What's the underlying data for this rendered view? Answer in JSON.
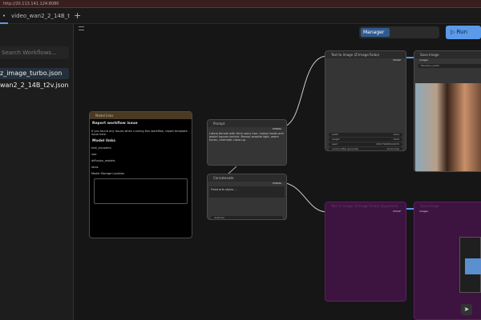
{
  "browser": {
    "url": "http://20.113.141.124:8080"
  },
  "tabs": [
    {
      "label": "•",
      "active": true
    },
    {
      "label": "video_wan2_2_14B_t...",
      "active": false
    }
  ],
  "add_tab": "+",
  "sidebar": {
    "search_placeholder": "Search Workflows...",
    "workflows": [
      {
        "label": "z_image_turbo.json",
        "selected": true
      },
      {
        "label": "wan2_2_14B_t2v.json",
        "selected": false
      }
    ]
  },
  "toolbar": {
    "manager": "Manager",
    "run": "Run"
  },
  "nodes": {
    "model_links": {
      "title": "Model links",
      "heading": "Report workflow issue",
      "intro": "If you found any issues when running this workflow, report template issue here",
      "subheading": "Model links",
      "sections": [
        "text_encoders",
        "vae",
        "diffusion_models",
        "loras"
      ],
      "storage": "Model Storage Location"
    },
    "prompt": {
      "title": "Prompt",
      "output": "STRING",
      "text": "Latina female with thick wavy hair, harbor boats and pastel houses behind. Breezy seaside light, warm tones, cinematic close-up."
    },
    "concat": {
      "title": "Concatenate",
      "output": "STRING",
      "text": "Fixed arts styles ...",
      "field": "delimiter"
    },
    "t2i": {
      "title": "Text to Image (Z-Image-Turbo)",
      "output": "IMAGE",
      "widgets": [
        {
          "label": "width",
          "value": "1024"
        },
        {
          "label": "height",
          "value": "1024"
        },
        {
          "label": "seed",
          "value": "936776483104470"
        },
        {
          "label": "control after generate",
          "value": "randomize"
        }
      ]
    },
    "save": {
      "title": "Save Image",
      "input": "images",
      "field": "filename_prefix"
    },
    "t2i_video": {
      "title": "Text to Image (Z-Image-Turbo) (bypassed)",
      "output": "IMAGE"
    },
    "save2": {
      "title": "Save Image",
      "input": "images"
    }
  }
}
